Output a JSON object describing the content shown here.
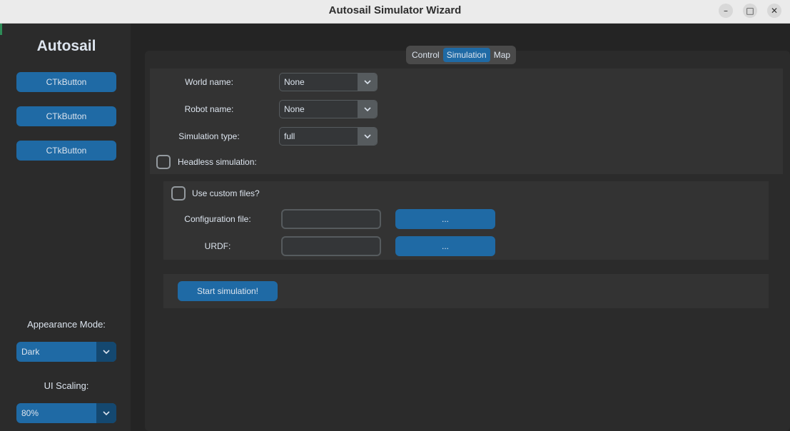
{
  "window": {
    "title": "Autosail Simulator Wizard",
    "controls": {
      "minimize": "–",
      "maximize": "□",
      "close": "✕"
    }
  },
  "sidebar": {
    "logo": "Autosail",
    "buttons": [
      {
        "label": "CTkButton"
      },
      {
        "label": "CTkButton"
      },
      {
        "label": "CTkButton"
      }
    ],
    "appearance_label": "Appearance Mode:",
    "appearance_value": "Dark",
    "scaling_label": "UI Scaling:",
    "scaling_value": "80%"
  },
  "tabs": [
    {
      "label": "Control",
      "active": false
    },
    {
      "label": "Simulation",
      "active": true
    },
    {
      "label": "Map",
      "active": false
    }
  ],
  "simulation": {
    "world_label": "World name:",
    "world_value": "None",
    "robot_label": "Robot name:",
    "robot_value": "None",
    "type_label": "Simulation type:",
    "type_value": "full",
    "headless_label": "Headless simulation:",
    "custom_label": "Use custom files?",
    "config_label": "Configuration file:",
    "config_value": "",
    "config_browse": "...",
    "urdf_label": "URDF:",
    "urdf_value": "",
    "urdf_browse": "...",
    "start_label": "Start simulation!"
  },
  "colors": {
    "accent": "#1f6aa5",
    "accent_dark": "#144870",
    "background": "#242424",
    "panel": "#333333"
  }
}
